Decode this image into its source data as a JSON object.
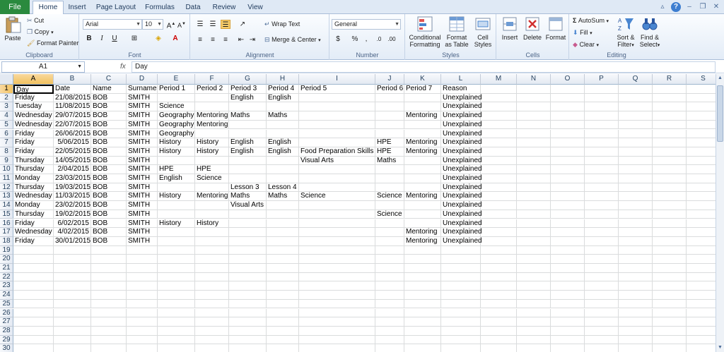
{
  "tabs": [
    "File",
    "Home",
    "Insert",
    "Page Layout",
    "Formulas",
    "Data",
    "Review",
    "View"
  ],
  "active_tab": "Home",
  "ribbon": {
    "clipboard": {
      "label": "Clipboard",
      "paste": "Paste",
      "cut": "Cut",
      "copy": "Copy",
      "format_painter": "Format Painter"
    },
    "font": {
      "label": "Font",
      "font_name": "Arial",
      "font_size": "10"
    },
    "alignment": {
      "label": "Alignment",
      "wrap_text": "Wrap Text",
      "merge_center": "Merge & Center"
    },
    "number": {
      "label": "Number",
      "format": "General"
    },
    "styles": {
      "label": "Styles",
      "conditional": "Conditional",
      "formatting": "Formatting",
      "format_as": "Format",
      "as_table": "as Table",
      "cell": "Cell",
      "styles": "Styles"
    },
    "cells": {
      "label": "Cells",
      "insert": "Insert",
      "delete": "Delete",
      "format": "Format"
    },
    "editing": {
      "label": "Editing",
      "autosum": "AutoSum",
      "fill": "Fill",
      "clear": "Clear",
      "sort": "Sort &",
      "filter": "Filter",
      "find": "Find &",
      "select": "Select"
    }
  },
  "formula_bar": {
    "name_box": "A1",
    "fx": "fx",
    "content": "Day"
  },
  "columns": [
    "A",
    "B",
    "C",
    "D",
    "E",
    "F",
    "G",
    "H",
    "I",
    "J",
    "K",
    "L",
    "M",
    "N",
    "O",
    "P",
    "Q",
    "R",
    "S"
  ],
  "rows": [
    [
      "Day",
      "Date",
      "Name",
      "Surname",
      "Period 1",
      "Period 2",
      "Period 3",
      "Period 4",
      "Period 5",
      "Period 6",
      "Period 7",
      "Reason"
    ],
    [
      "Friday",
      "21/08/2015",
      "BOB",
      "SMITH",
      "",
      "",
      "English",
      "English",
      "",
      "",
      "",
      "Unexplained"
    ],
    [
      "Tuesday",
      "11/08/2015",
      "BOB",
      "SMITH",
      "Science",
      "",
      "",
      "",
      "",
      "",
      "",
      "Unexplained"
    ],
    [
      "Wednesday",
      "29/07/2015",
      "BOB",
      "SMITH",
      "Geography",
      "Mentoring",
      "Maths",
      "Maths",
      "",
      "",
      "Mentoring",
      "Unexplained"
    ],
    [
      "Wednesday",
      "22/07/2015",
      "BOB",
      "SMITH",
      "Geography",
      "Mentoring",
      "",
      "",
      "",
      "",
      "",
      "Unexplained"
    ],
    [
      "Friday",
      "26/06/2015",
      "BOB",
      "SMITH",
      "Geography",
      "",
      "",
      "",
      "",
      "",
      "",
      "Unexplained"
    ],
    [
      "Friday",
      "5/06/2015",
      "BOB",
      "SMITH",
      "History",
      "History",
      "English",
      "English",
      "",
      "HPE",
      "Mentoring",
      "Unexplained"
    ],
    [
      "Friday",
      "22/05/2015",
      "BOB",
      "SMITH",
      "History",
      "History",
      "English",
      "English",
      "Food Preparation Skills",
      "HPE",
      "Mentoring",
      "Unexplained"
    ],
    [
      "Thursday",
      "14/05/2015",
      "BOB",
      "SMITH",
      "",
      "",
      "",
      "",
      "Visual Arts",
      "Maths",
      "",
      "Unexplained"
    ],
    [
      "Thursday",
      "2/04/2015",
      "BOB",
      "SMITH",
      "HPE",
      "HPE",
      "",
      "",
      "",
      "",
      "",
      "Unexplained"
    ],
    [
      "Monday",
      "23/03/2015",
      "BOB",
      "SMITH",
      "English",
      "Science",
      "",
      "",
      "",
      "",
      "",
      "Unexplained"
    ],
    [
      "Thursday",
      "19/03/2015",
      "BOB",
      "SMITH",
      "",
      "",
      "Lesson 3",
      "Lesson 4",
      "",
      "",
      "",
      "Unexplained"
    ],
    [
      "Wednesday",
      "11/03/2015",
      "BOB",
      "SMITH",
      "History",
      "Mentoring",
      "Maths",
      "Maths",
      "Science",
      "Science",
      "Mentoring",
      "Unexplained"
    ],
    [
      "Monday",
      "23/02/2015",
      "BOB",
      "SMITH",
      "",
      "",
      "Visual Arts",
      "",
      "",
      "",
      "",
      "Unexplained"
    ],
    [
      "Thursday",
      "19/02/2015",
      "BOB",
      "SMITH",
      "",
      "",
      "",
      "",
      "",
      "Science",
      "",
      "Unexplained"
    ],
    [
      "Friday",
      "6/02/2015",
      "BOB",
      "SMITH",
      "History",
      "History",
      "",
      "",
      "",
      "",
      "",
      "Unexplained"
    ],
    [
      "Wednesday",
      "4/02/2015",
      "BOB",
      "SMITH",
      "",
      "",
      "",
      "",
      "",
      "",
      "Mentoring",
      "Unexplained"
    ],
    [
      "Friday",
      "30/01/2015",
      "BOB",
      "SMITH",
      "",
      "",
      "",
      "",
      "",
      "",
      "Mentoring",
      "Unexplained"
    ]
  ],
  "total_rows": 30,
  "right_aligned_columns": [
    1
  ]
}
